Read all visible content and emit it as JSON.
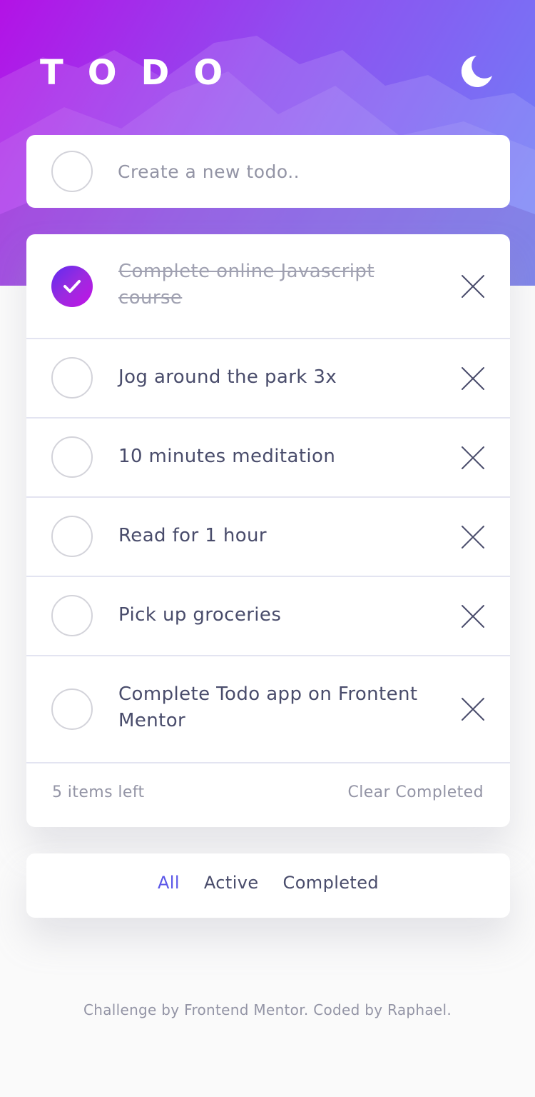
{
  "header": {
    "title": "TODO",
    "theme_toggle_icon": "moon-icon"
  },
  "create": {
    "placeholder": "Create a new todo.."
  },
  "todos": [
    {
      "text": "Complete online Javascript course",
      "completed": true
    },
    {
      "text": "Jog around the park 3x",
      "completed": false
    },
    {
      "text": "10 minutes meditation",
      "completed": false
    },
    {
      "text": "Read for 1 hour",
      "completed": false
    },
    {
      "text": "Pick up groceries",
      "completed": false
    },
    {
      "text": "Complete Todo app on Frontent Mentor",
      "completed": false
    }
  ],
  "footer": {
    "items_left": "5 items left",
    "clear_completed": "Clear Completed"
  },
  "filters": {
    "all": "All",
    "active": "Active",
    "completed": "Completed",
    "selected": "All"
  },
  "attribution": "Challenge by Frontend Mentor. Coded by Raphael.",
  "colors": {
    "accent": "#5b57e8",
    "gradient_start": "#b312e6",
    "gradient_end": "#6d83f7",
    "text_dark": "#494c6b",
    "text_muted": "#9394a5"
  }
}
